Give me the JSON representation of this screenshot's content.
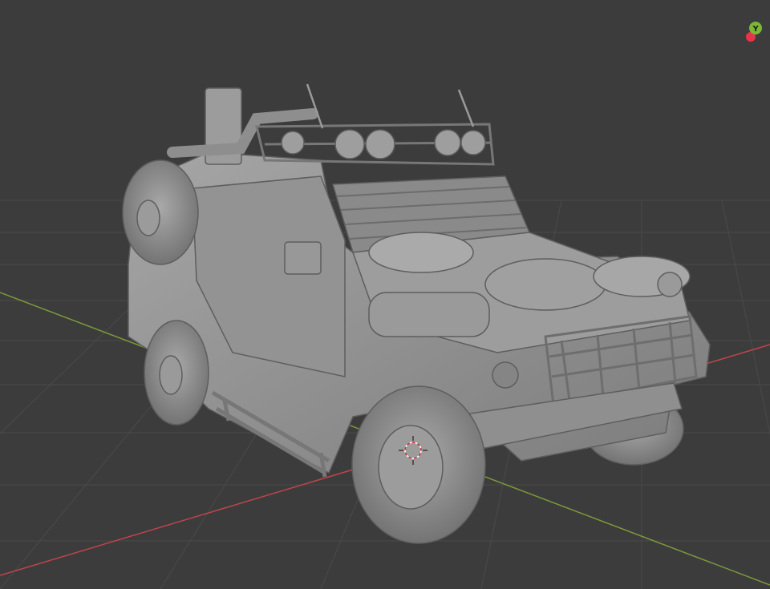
{
  "viewport": {
    "background": "#3c3c3c",
    "grid_color": "#4a4a4a",
    "x_axis_color": "#c0454c",
    "y_axis_color": "#7a9a3a"
  },
  "navigation_gizmo": {
    "y_label": "Y",
    "y_color": "#7bb833",
    "x_color": "#e8344a"
  },
  "model": {
    "kind": "armored vehicle",
    "material_color": "#8c8c8c",
    "selected": false
  },
  "cursor_3d": {
    "visible": true
  }
}
